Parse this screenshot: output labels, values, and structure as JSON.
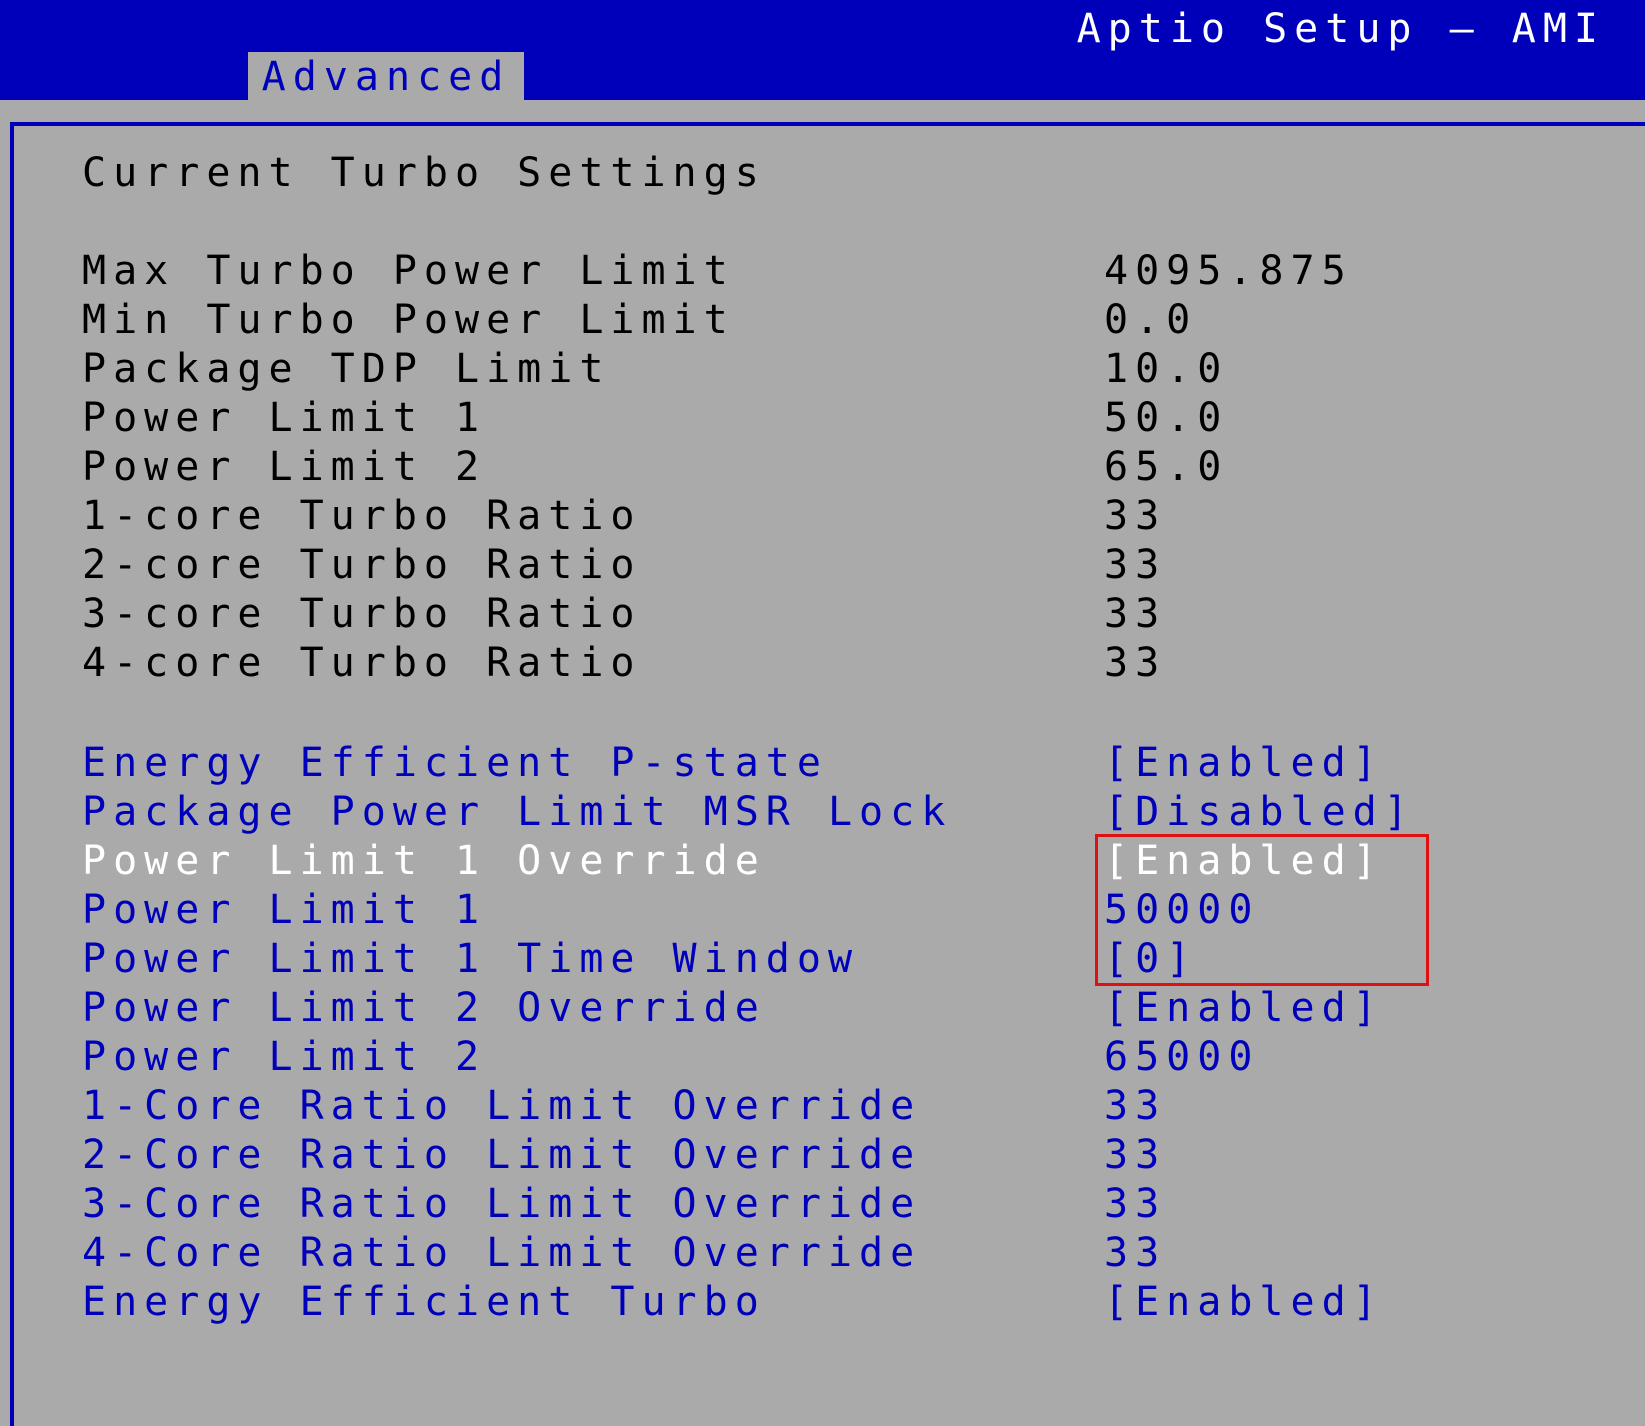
{
  "header": {
    "app_title": "Aptio Setup – AMI",
    "tab_label": "Advanced"
  },
  "section_title": "Current Turbo Settings",
  "info_rows": [
    {
      "label": "Max Turbo Power Limit",
      "value": "4095.875"
    },
    {
      "label": "Min Turbo Power Limit",
      "value": "0.0"
    },
    {
      "label": "Package TDP Limit",
      "value": "10.0"
    },
    {
      "label": "Power Limit 1",
      "value": "50.0"
    },
    {
      "label": "Power Limit 2",
      "value": "65.0"
    },
    {
      "label": "1-core Turbo Ratio",
      "value": "33"
    },
    {
      "label": "2-core Turbo Ratio",
      "value": "33"
    },
    {
      "label": "3-core Turbo Ratio",
      "value": "33"
    },
    {
      "label": "4-core Turbo Ratio",
      "value": "33"
    }
  ],
  "option_rows": [
    {
      "label": "Energy Efficient P-state",
      "value": "[Enabled]"
    },
    {
      "label": "Package Power Limit MSR Lock",
      "value": "[Disabled]"
    },
    {
      "label": "Power Limit 1 Override",
      "value": "[Enabled]"
    },
    {
      "label": "Power Limit 1",
      "value": "50000"
    },
    {
      "label": "Power Limit 1 Time Window",
      "value": "[0]"
    },
    {
      "label": "Power Limit 2 Override",
      "value": "[Enabled]"
    },
    {
      "label": "Power Limit 2",
      "value": "65000"
    },
    {
      "label": "1-Core Ratio Limit Override",
      "value": "33"
    },
    {
      "label": "2-Core Ratio Limit Override",
      "value": "33"
    },
    {
      "label": "3-Core Ratio Limit Override",
      "value": "33"
    },
    {
      "label": "4-Core Ratio Limit Override",
      "value": "33"
    },
    {
      "label": "Energy Efficient Turbo",
      "value": "[Enabled]"
    }
  ],
  "selected_option": "Power Limit 1 Override",
  "colors": {
    "header_blue": "#0000bb",
    "panel_gray": "#aaaaaa",
    "option_text": "#0000bb",
    "selected_text": "#ffffff",
    "info_text": "#000000",
    "highlight_box": "#e01010"
  }
}
